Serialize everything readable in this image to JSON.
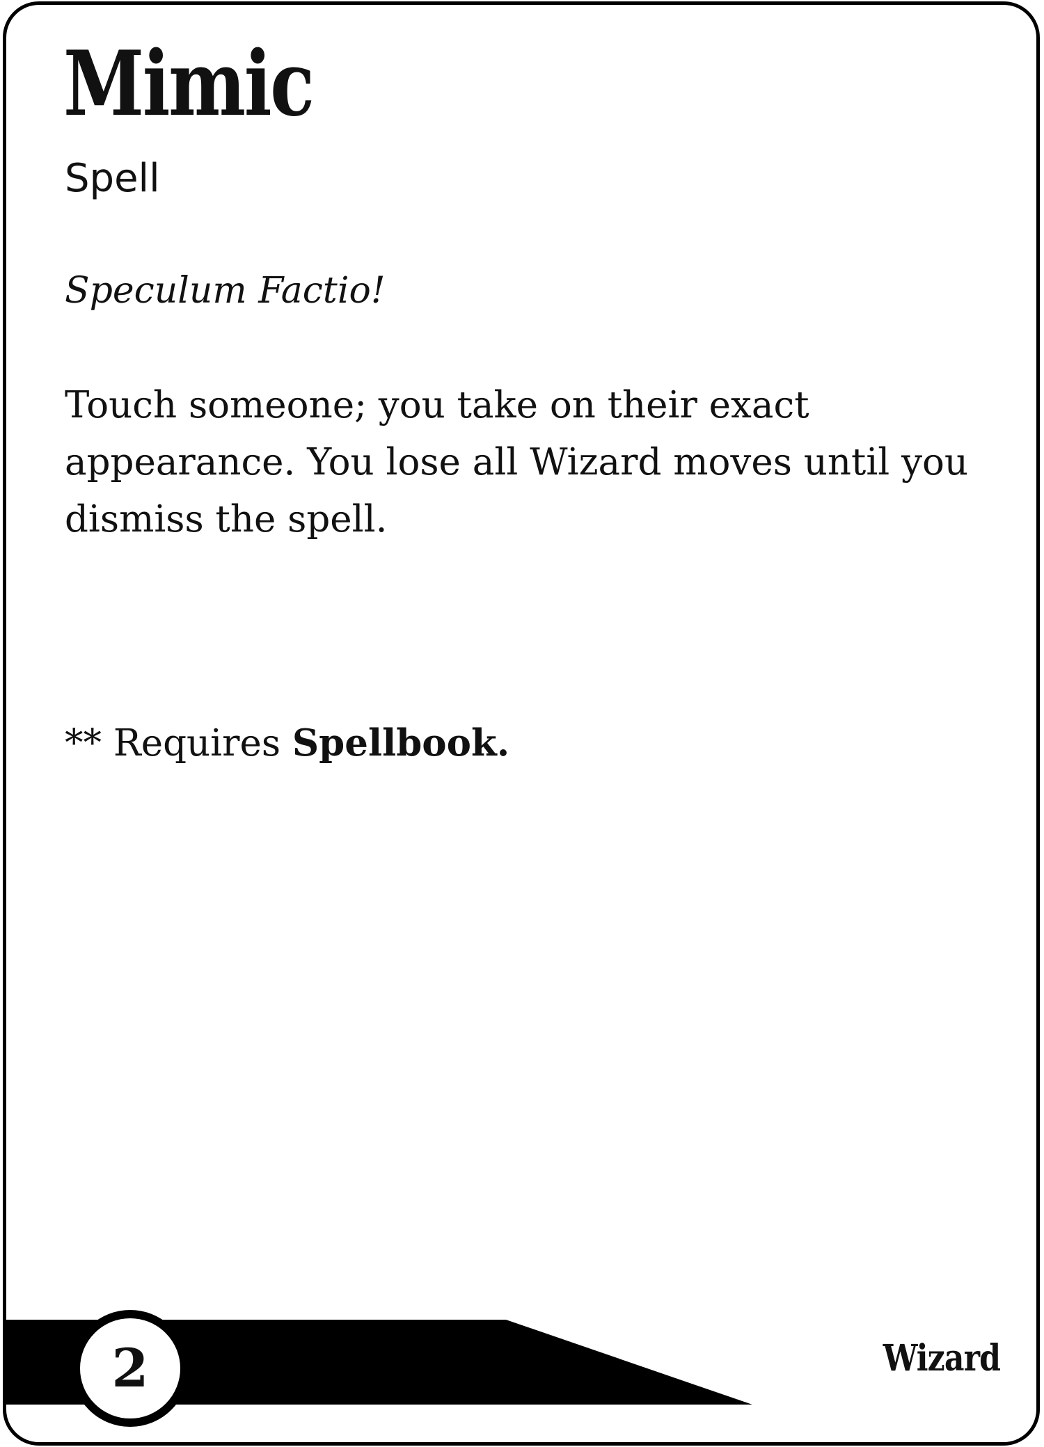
{
  "card": {
    "title": "Mimic",
    "type": "Spell",
    "incantation": "Speculum Factio!",
    "description": "Touch someone; you take on their exact appearance. You lose all Wizard moves until you dismiss the spell.",
    "requirement_prefix": "** Requires ",
    "requirement_item": "Spellbook."
  },
  "footer": {
    "level": "2",
    "class_name": "Wizard"
  },
  "colors": {
    "ink": "#111111",
    "background": "#ffffff",
    "banner": "#000000"
  }
}
